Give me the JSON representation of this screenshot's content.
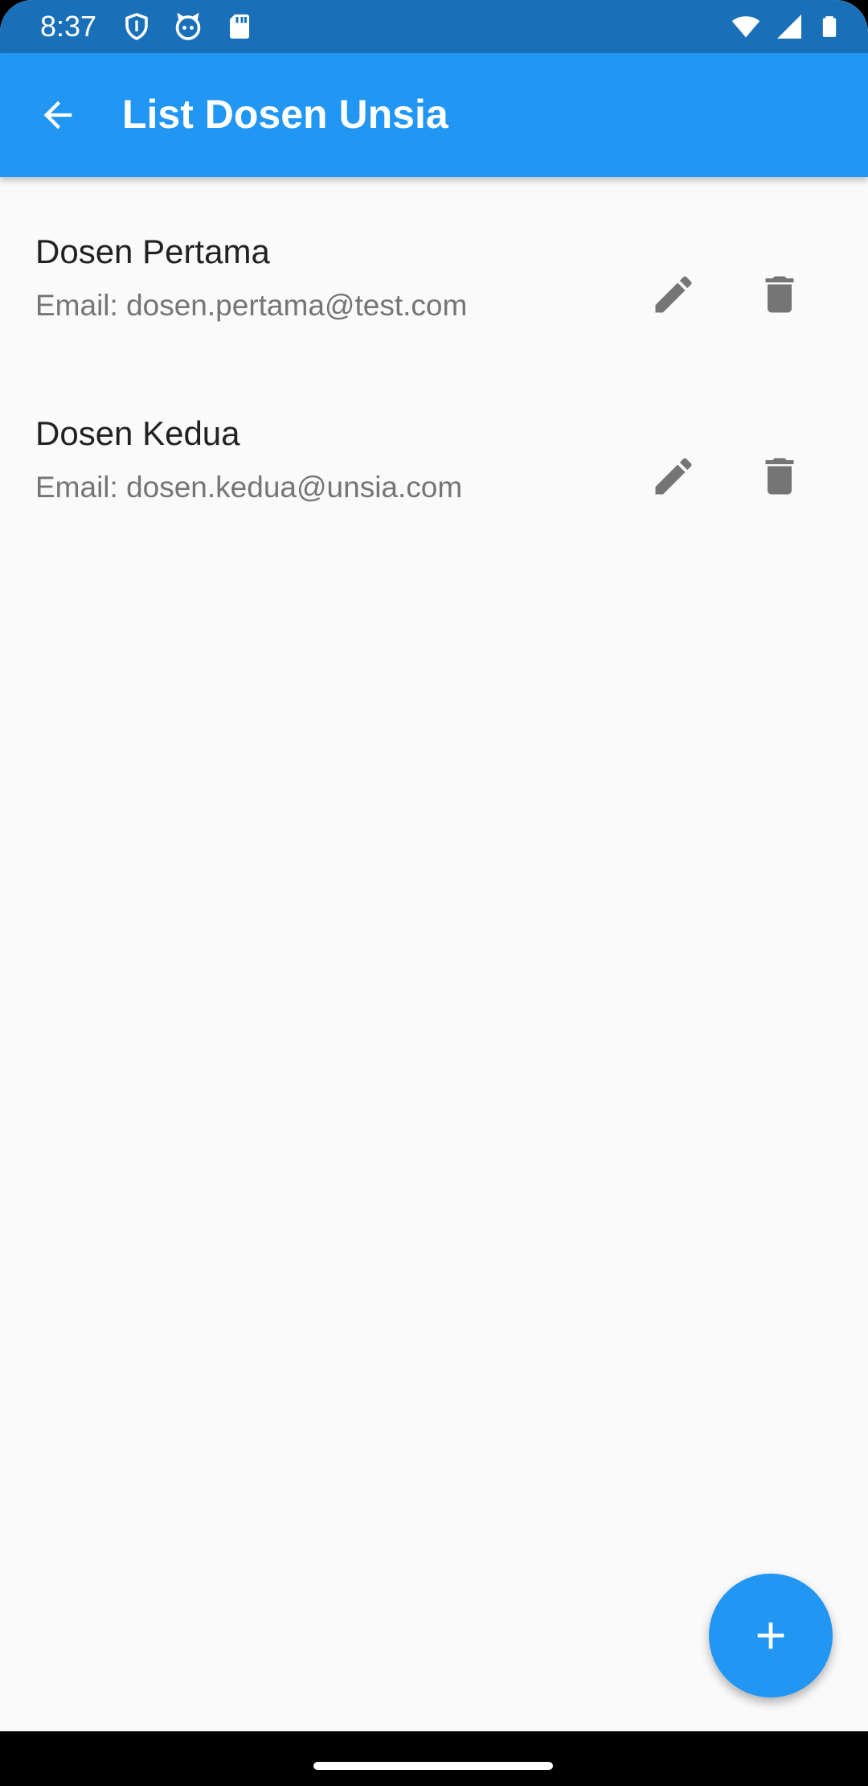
{
  "status_bar": {
    "time": "8:37",
    "left_icons": [
      "shield-icon",
      "cat-face-icon",
      "sd-card-icon"
    ],
    "right_icons": [
      "wifi-icon",
      "cell-signal-icon",
      "battery-icon"
    ]
  },
  "app_bar": {
    "back_icon": "arrow-back-icon",
    "title": "List Dosen Unsia",
    "color": "#2196f3"
  },
  "list": {
    "items": [
      {
        "name": "Dosen Pertama",
        "email": "Email: dosen.pertama@test.com",
        "edit_icon": "pencil-icon",
        "delete_icon": "trash-icon"
      },
      {
        "name": "Dosen Kedua",
        "email": "Email: dosen.kedua@unsia.com",
        "edit_icon": "pencil-icon",
        "delete_icon": "trash-icon"
      }
    ]
  },
  "fab": {
    "icon": "plus-icon",
    "color": "#2196f3"
  },
  "nav_bar": {
    "handle": "home-handle"
  }
}
